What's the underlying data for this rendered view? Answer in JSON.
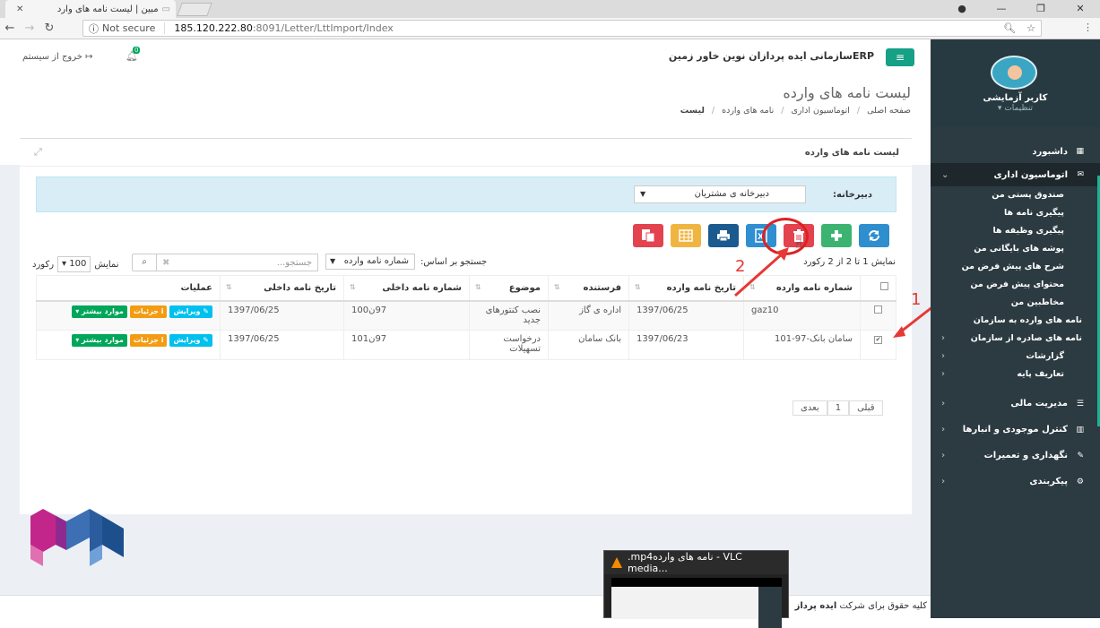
{
  "browser": {
    "tab_title": "مبین | لیست نامه های وارد",
    "address_secure": "Not secure",
    "address_host": "185.120.222.80",
    "address_path": ":8091/Letter/LttImport/Index"
  },
  "topbar": {
    "brand": "ERPسازمانی ایده پردازان نوین خاور زمین",
    "notif_count": "0",
    "logout": "خروج از سیستم"
  },
  "user": {
    "name": "کاربر آزمایشی",
    "settings": "تنظیمات"
  },
  "sidebar": {
    "dashboard": "داشبورد",
    "office": "اتوماسیون اداری",
    "sub_items": [
      "صندوق پستی من",
      "پیگیری نامه ها",
      "پیگیری وظیفه ها",
      "پوشه های بایگانی من",
      "شرح های پیش فرض من",
      "محتوای پیش فرض من",
      "مخاطبین من",
      "نامه های وارده به سازمان",
      "نامه های صادره از سازمان",
      "گزارشات",
      "تعاریف پایه"
    ],
    "others": [
      "مدیریت مالی",
      "کنترل موجودی و انبارها",
      "نگهداری و تعمیرات",
      "پیکربندی"
    ]
  },
  "page": {
    "title": "لیست نامه های وارده",
    "breadcrumb": [
      "صفحه اصلی",
      "اتوماسیون اداری",
      "نامه های وارده",
      "لیست"
    ]
  },
  "box": {
    "title": "لیست نامه های وارده",
    "filter_label": "دبیرخانه:",
    "filter_value": "دبیرخانه ی مشتریان"
  },
  "colors": {
    "refresh": "#2e8ece",
    "add": "#3cb371",
    "excel": "#2f8fd1",
    "print": "#1b5a8f",
    "grid": "#f0b541",
    "pdf": "#e3424f",
    "delete": "#e3424f"
  },
  "controls": {
    "show_label": "نمایش",
    "show_value": "100",
    "show_suffix": "رکورد",
    "search_placeholder": "جستجو...",
    "search_by_label": "جستجو بر اساس:",
    "search_by_value": "شماره نامه وارده",
    "count_info": "نمایش 1 تا 2 از 2 رکورد"
  },
  "table": {
    "headers": [
      "شماره نامه وارده",
      "تاریخ نامه وارده",
      "فرستنده",
      "موضوع",
      "شماره نامه داخلی",
      "تاریخ نامه داخلی",
      "عملیات"
    ],
    "rows": [
      {
        "number": "gaz10",
        "date": "1397/06/25",
        "sender": "اداره ی گاز",
        "subject": "نصب کنتورهای جدید",
        "internal_no": "97ن100",
        "internal_date": "1397/06/25",
        "checked": false
      },
      {
        "number": "سامان بانک-97-101",
        "date": "1397/06/23",
        "sender": "بانک سامان",
        "subject": "درخواست تسهیلات",
        "internal_no": "97ن101",
        "internal_date": "1397/06/25",
        "checked": true
      }
    ],
    "btn_edit": "ویرایش",
    "btn_details": "جزئیات",
    "btn_more": "موارد بیشتر"
  },
  "pager": {
    "prev": "قبلی",
    "page": "1",
    "next": "بعدی"
  },
  "annotations": {
    "one": "1",
    "two": "2"
  },
  "footer": {
    "prefix": "کلیه حقوق برای شرکت",
    "company": "ایده پرداز"
  },
  "vlc": {
    "title": ".mp4نامه های وارده - VLC media..."
  }
}
